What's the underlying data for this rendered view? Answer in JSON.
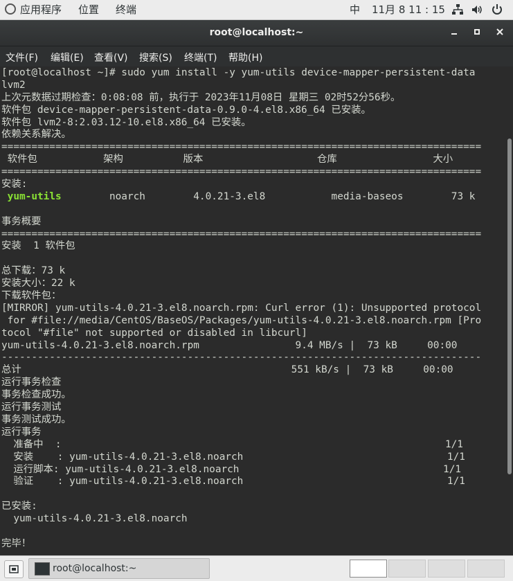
{
  "topbar": {
    "apps": "应用程序",
    "places": "位置",
    "terminal": "终端",
    "input_method": "中",
    "clock": "11月 8  11 : 15",
    "tray_icons": [
      "network-icon",
      "volume-icon",
      "power-icon"
    ]
  },
  "window": {
    "title": "root@localhost:~"
  },
  "menubar": {
    "items": [
      "文件(F)",
      "编辑(E)",
      "查看(V)",
      "搜索(S)",
      "终端(T)",
      "帮助(H)"
    ]
  },
  "terminal": {
    "lines": [
      "[root@localhost ~]# sudo yum install -y yum-utils device-mapper-persistent-data",
      "lvm2",
      "上次元数据过期检查：0:08:08 前，执行于 2023年11月08日 星期三 02时52分56秒。",
      "软件包 device-mapper-persistent-data-0.9.0-4.el8.x86_64 已安装。",
      "软件包 lvm2-8:2.03.12-10.el8.x86_64 已安装。",
      "依赖关系解决。",
      "================================================================================",
      " 软件包           架构          版本                   仓库                大小",
      "================================================================================",
      "安装:",
      " yum-utils        noarch        4.0.21-3.el8           media-baseos        73 k",
      "",
      "事务概要",
      "================================================================================",
      "安装  1 软件包",
      "",
      "总下载：73 k",
      "安装大小：22 k",
      "下载软件包：",
      "[MIRROR] yum-utils-4.0.21-3.el8.noarch.rpm: Curl error (1): Unsupported protocol",
      " for #file://media/CentOS/BaseOS/Packages/yum-utils-4.0.21-3.el8.noarch.rpm [Pro",
      "tocol \"#file\" not supported or disabled in libcurl]",
      "yum-utils-4.0.21-3.el8.noarch.rpm                9.4 MB/s |  73 kB     00:00",
      "--------------------------------------------------------------------------------",
      "总计                                             551 kB/s |  73 kB     00:00",
      "运行事务检查",
      "事务检查成功。",
      "运行事务测试",
      "事务测试成功。",
      "运行事务",
      "  准备中  :                                                                1/1",
      "  安装    : yum-utils-4.0.21-3.el8.noarch                                  1/1",
      "  运行脚本: yum-utils-4.0.21-3.el8.noarch                                  1/1",
      "  验证    : yum-utils-4.0.21-3.el8.noarch                                  1/1",
      "",
      "已安装:",
      "  yum-utils-4.0.21-3.el8.noarch",
      "",
      "完毕！"
    ],
    "highlight": {
      "line": 10,
      "text": "yum-utils"
    },
    "highlight_color": "#8ae234"
  },
  "taskbar": {
    "task_label": "root@localhost:~",
    "workspaces": 4,
    "active_workspace": 1
  }
}
